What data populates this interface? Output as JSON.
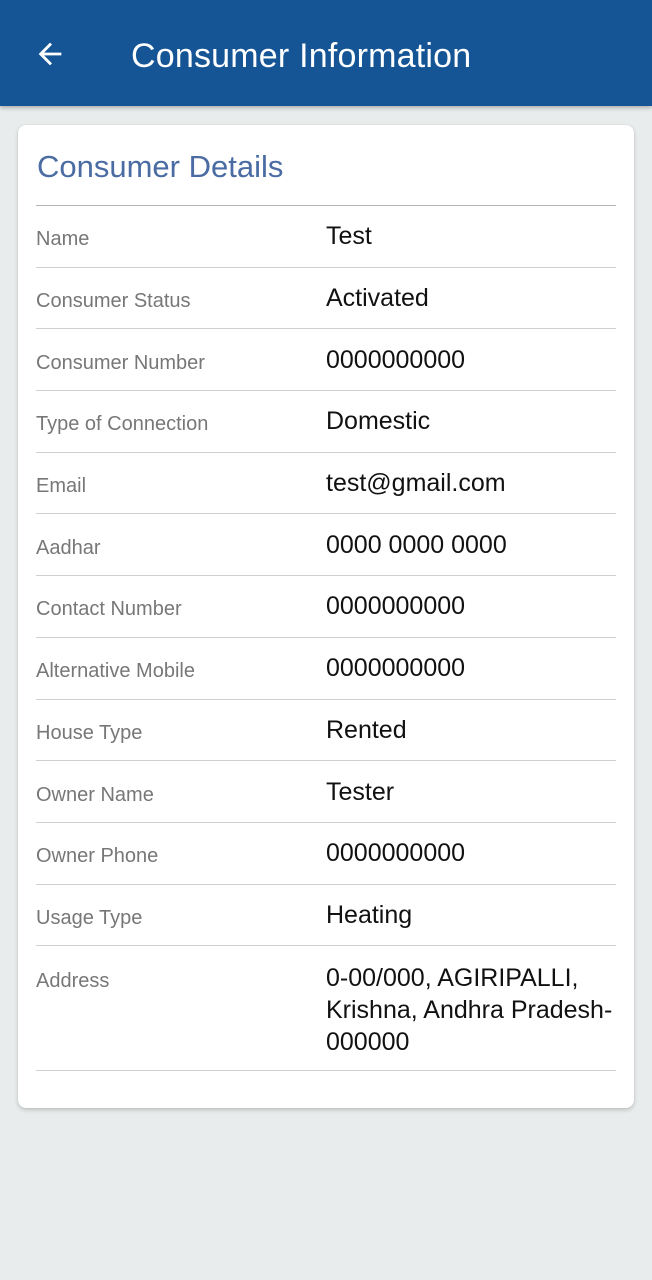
{
  "app_bar": {
    "back_icon": "arrow-left-icon",
    "title": "Consumer Information",
    "color": "#155596"
  },
  "card": {
    "title": "Consumer Details",
    "title_color": "#4a6ca3",
    "fields": [
      {
        "label": "Name",
        "value": "Test"
      },
      {
        "label": "Consumer Status",
        "value": "Activated"
      },
      {
        "label": "Consumer Number",
        "value": "0000000000"
      },
      {
        "label": "Type of Connection",
        "value": "Domestic"
      },
      {
        "label": "Email",
        "value": "test@gmail.com"
      },
      {
        "label": "Aadhar",
        "value": "0000 0000 0000"
      },
      {
        "label": "Contact Number",
        "value": "0000000000"
      },
      {
        "label": "Alternative Mobile",
        "value": "0000000000"
      },
      {
        "label": "House Type",
        "value": "Rented"
      },
      {
        "label": "Owner Name",
        "value": "Tester"
      },
      {
        "label": "Owner Phone",
        "value": "0000000000"
      },
      {
        "label": "Usage Type",
        "value": "Heating"
      },
      {
        "label": "Address",
        "value": "0-00/000, AGIRIPALLI, Krishna, Andhra Pradesh-000000"
      }
    ]
  }
}
